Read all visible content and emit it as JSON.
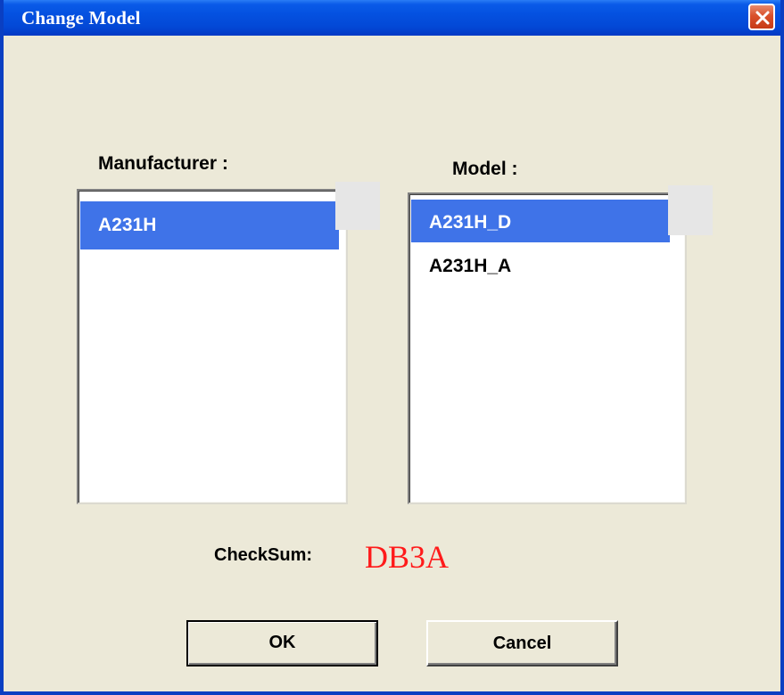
{
  "window": {
    "title": "Change Model",
    "close_icon": "close-icon"
  },
  "manufacturer": {
    "label": "Manufacturer :",
    "items": [
      {
        "label": "A231H",
        "selected": true
      }
    ]
  },
  "model": {
    "label": "Model :",
    "items": [
      {
        "label": "A231H_D",
        "selected": true
      },
      {
        "label": "A231H_A",
        "selected": false
      }
    ]
  },
  "checksum": {
    "label": "CheckSum:",
    "value": "DB3A",
    "value_color": "#ff1a1a"
  },
  "buttons": {
    "ok_label": "OK",
    "cancel_label": "Cancel"
  },
  "colors": {
    "titlebar": "#0451e0",
    "selection": "#3f73e8",
    "dialog_bg": "#ece9d8"
  }
}
